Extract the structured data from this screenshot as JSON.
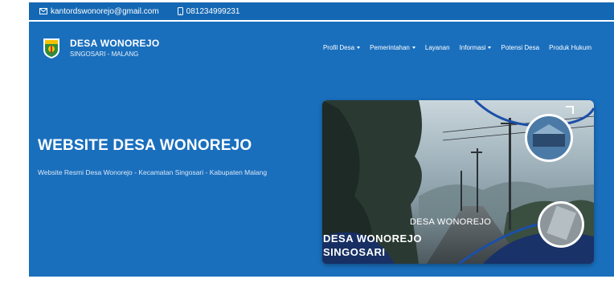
{
  "topbar": {
    "email": "kantordswonorejo@gmail.com",
    "phone": "081234999231",
    "email_icon": "envelope-icon",
    "phone_icon": "phone-icon"
  },
  "brand": {
    "title": "DESA WONOREJO",
    "subtitle": "SINGOSARI - MALANG",
    "logo_icon": "shield-emblem-icon"
  },
  "nav": {
    "items": [
      {
        "label": "Profil Desa",
        "dropdown": true
      },
      {
        "label": "Pemerintahan",
        "dropdown": true
      },
      {
        "label": "Layanan",
        "dropdown": false
      },
      {
        "label": "Informasi",
        "dropdown": true
      },
      {
        "label": "Potensi Desa",
        "dropdown": false
      },
      {
        "label": "Produk Hukum",
        "dropdown": false
      }
    ]
  },
  "hero": {
    "title": "WEBSITE DESA WONOREJO",
    "subtitle": "Website Resmi Desa Wonorejo - Kecamatan Singosari - Kabupaten Malang",
    "image": {
      "caption_right": "DESA WONOREJO",
      "caption_left_1": "DESA WONOREJO",
      "caption_left_2": "SINGOSARI"
    }
  },
  "colors": {
    "primary": "#1a6fbd",
    "topbar": "#1468b3",
    "accent_yellow": "#f2c200"
  }
}
